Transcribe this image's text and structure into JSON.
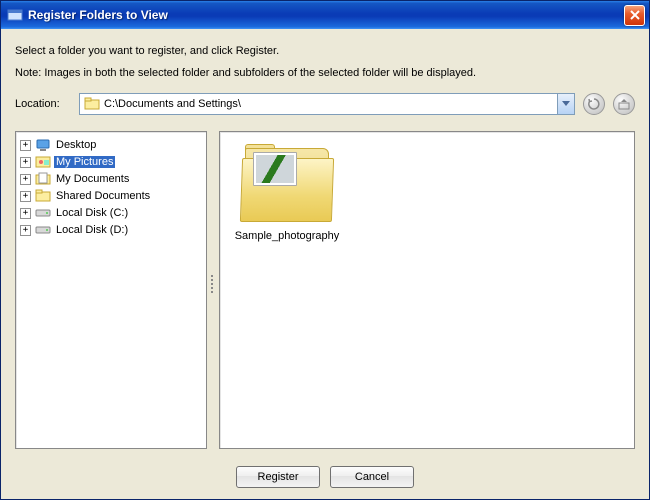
{
  "window": {
    "title": "Register Folders to View"
  },
  "instructions": {
    "line1": "Select a folder you want to register, and click Register.",
    "line2": "Note: Images in both the selected folder and subfolders of the selected folder will be displayed."
  },
  "location": {
    "label": "Location:",
    "path": "C:\\Documents and Settings\\"
  },
  "tree": {
    "items": [
      {
        "label": "Desktop",
        "icon": "desktop-icon",
        "selected": false
      },
      {
        "label": "My Pictures",
        "icon": "pictures-icon",
        "selected": true
      },
      {
        "label": "My Documents",
        "icon": "documents-icon",
        "selected": false
      },
      {
        "label": "Shared Documents",
        "icon": "folder-icon",
        "selected": false
      },
      {
        "label": "Local Disk (C:)",
        "icon": "disk-icon",
        "selected": false
      },
      {
        "label": "Local Disk (D:)",
        "icon": "disk-icon",
        "selected": false
      }
    ]
  },
  "content": {
    "items": [
      {
        "label": "Sample_photography"
      }
    ]
  },
  "buttons": {
    "register": "Register",
    "cancel": "Cancel"
  },
  "expand_glyph": "+"
}
